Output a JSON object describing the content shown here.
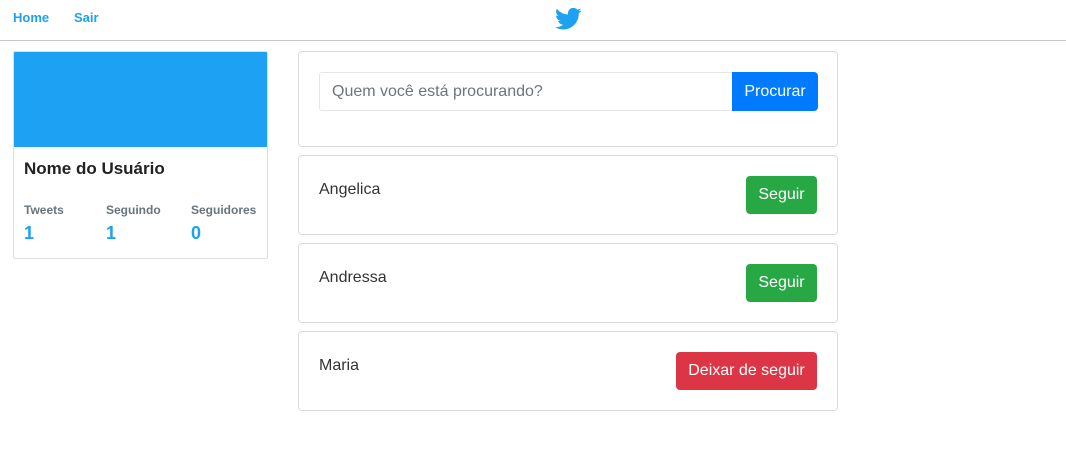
{
  "nav": {
    "home_label": "Home",
    "logout_label": "Sair"
  },
  "profile": {
    "name": "Nome do Usuário",
    "stats": [
      {
        "label": "Tweets",
        "value": "1"
      },
      {
        "label": "Seguindo",
        "value": "1"
      },
      {
        "label": "Seguidores",
        "value": "0"
      }
    ]
  },
  "search": {
    "placeholder": "Quem você está procurando?",
    "value": "",
    "button_label": "Procurar"
  },
  "users": [
    {
      "name": "Angelica",
      "action": "Seguir"
    },
    {
      "name": "Andressa",
      "action": "Seguir"
    },
    {
      "name": "Maria",
      "action": "Deixar de seguir"
    }
  ],
  "colors": {
    "brand": "#1da1f2",
    "primary": "#007bff",
    "follow": "#28a745",
    "unfollow": "#dc3545"
  }
}
